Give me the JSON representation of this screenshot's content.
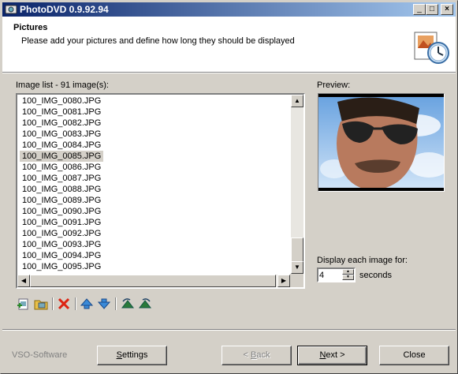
{
  "window": {
    "title": "PhotoDVD 0.9.92.94",
    "controls": {
      "minimize": "_",
      "maximize": "□",
      "close": "×"
    }
  },
  "header": {
    "title": "Pictures",
    "subtitle": "Please add your pictures and define how long they should be displayed",
    "icon": "picture-clock-icon"
  },
  "image_list": {
    "label": "Image list - 91 image(s):",
    "items": [
      "100_IMG_0080.JPG",
      "100_IMG_0081.JPG",
      "100_IMG_0082.JPG",
      "100_IMG_0083.JPG",
      "100_IMG_0084.JPG",
      "100_IMG_0085.JPG",
      "100_IMG_0086.JPG",
      "100_IMG_0087.JPG",
      "100_IMG_0088.JPG",
      "100_IMG_0089.JPG",
      "100_IMG_0090.JPG",
      "100_IMG_0091.JPG",
      "100_IMG_0092.JPG",
      "100_IMG_0093.JPG",
      "100_IMG_0094.JPG",
      "100_IMG_0095.JPG"
    ],
    "selected_index": 5
  },
  "preview": {
    "label": "Preview:",
    "image": "portrait-man-sunglasses-sky"
  },
  "display": {
    "label": "Display each image for:",
    "value": "4",
    "unit": "seconds"
  },
  "toolbar": {
    "tools": [
      "add-picture-icon",
      "add-folder-icon",
      "delete-icon",
      "move-up-icon",
      "move-down-icon",
      "rotate-left-icon",
      "rotate-right-icon"
    ]
  },
  "footer": {
    "brand": "VSO-Software",
    "settings": "Settings",
    "back": "< Back",
    "next": "Next >",
    "close": "Close"
  },
  "colors": {
    "titlebar_start": "#0a246a",
    "titlebar_end": "#a6caf0",
    "face": "#d4d0c8",
    "selection": "#d4d0c8"
  }
}
